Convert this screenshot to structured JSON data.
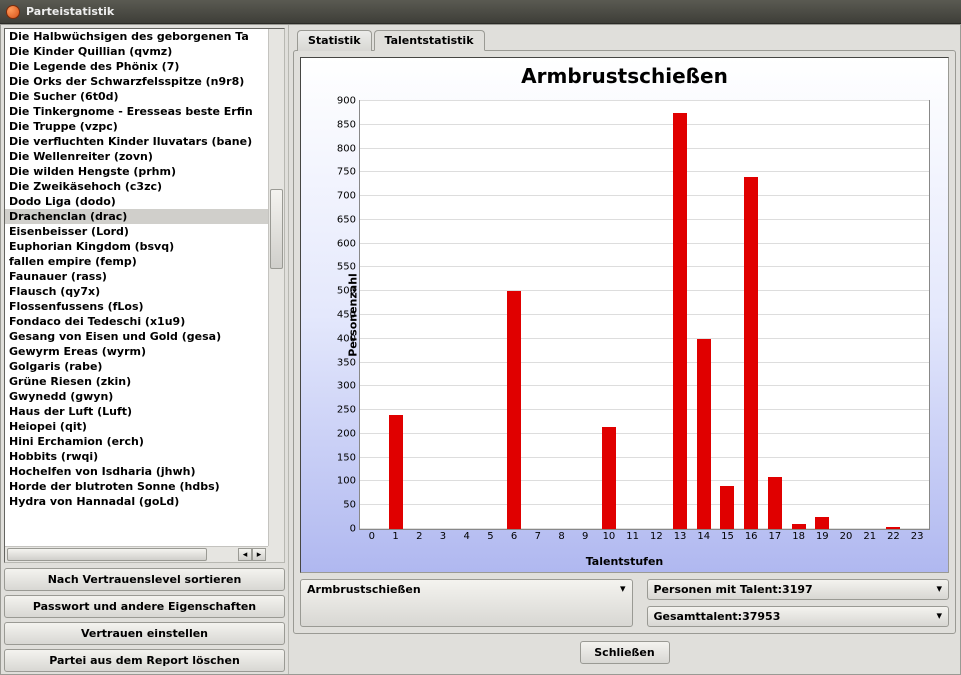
{
  "window": {
    "title": "Parteistatistik"
  },
  "sidebar": {
    "selected_index": 12,
    "items": [
      "Die Halbwüchsigen des geborgenen Ta",
      "Die Kinder Quillian (qvmz)",
      "Die Legende des Phönix (7)",
      "Die Orks der Schwarzfelsspitze (n9r8)",
      "Die Sucher (6t0d)",
      "Die Tinkergnome - Eresseas beste Erfin",
      "Die Truppe (vzpc)",
      "Die verfluchten Kinder Iluvatars (bane)",
      "Die Wellenreiter (zovn)",
      "Die wilden Hengste (prhm)",
      "Die Zweikäsehoch (c3zc)",
      "Dodo Liga (dodo)",
      "Drachenclan (drac)",
      "Eisenbeisser (Lord)",
      "Euphorian Kingdom (bsvq)",
      "fallen empire (femp)",
      "Faunauer (rass)",
      "Flausch (qy7x)",
      "Flossenfussens (fLos)",
      "Fondaco dei Tedeschi (x1u9)",
      "Gesang von Eisen und Gold (gesa)",
      "Gewyrm Ereas (wyrm)",
      "Golgaris (rabe)",
      "Grüne Riesen (zkin)",
      "Gwynedd (gwyn)",
      "Haus der Luft (Luft)",
      "Heiopei (qit)",
      "Hini Erchamion (erch)",
      "Hobbits (rwqi)",
      "Hochelfen von Isdharia (jhwh)",
      "Horde der blutroten Sonne (hdbs)",
      "Hydra von Hannadal (goLd)"
    ],
    "buttons": {
      "sort": "Nach Vertrauenslevel sortieren",
      "properties": "Passwort und andere Eigenschaften",
      "set_trust": "Vertrauen einstellen",
      "delete": "Partei aus dem Report löschen"
    }
  },
  "tabs": {
    "stat": "Statistik",
    "talent": "Talentstatistik"
  },
  "selects": {
    "talent": "Armbrustschießen",
    "persons": "Personen mit Talent:3197",
    "total": "Gesamttalent:37953"
  },
  "footer": {
    "close": "Schließen"
  },
  "chart_data": {
    "type": "bar",
    "title": "Armbrustschießen",
    "xlabel": "Talentstufen",
    "ylabel": "Personenzahl",
    "categories": [
      0,
      1,
      2,
      3,
      4,
      5,
      6,
      7,
      8,
      9,
      10,
      11,
      12,
      13,
      14,
      15,
      16,
      17,
      18,
      19,
      20,
      21,
      22,
      23
    ],
    "values": [
      0,
      240,
      0,
      0,
      0,
      0,
      500,
      0,
      0,
      0,
      215,
      0,
      0,
      875,
      400,
      90,
      740,
      110,
      10,
      25,
      0,
      0,
      5,
      0
    ],
    "ylim": [
      0,
      900
    ],
    "yticks": [
      0,
      50,
      100,
      150,
      200,
      250,
      300,
      350,
      400,
      450,
      500,
      550,
      600,
      650,
      700,
      750,
      800,
      850,
      900
    ]
  }
}
